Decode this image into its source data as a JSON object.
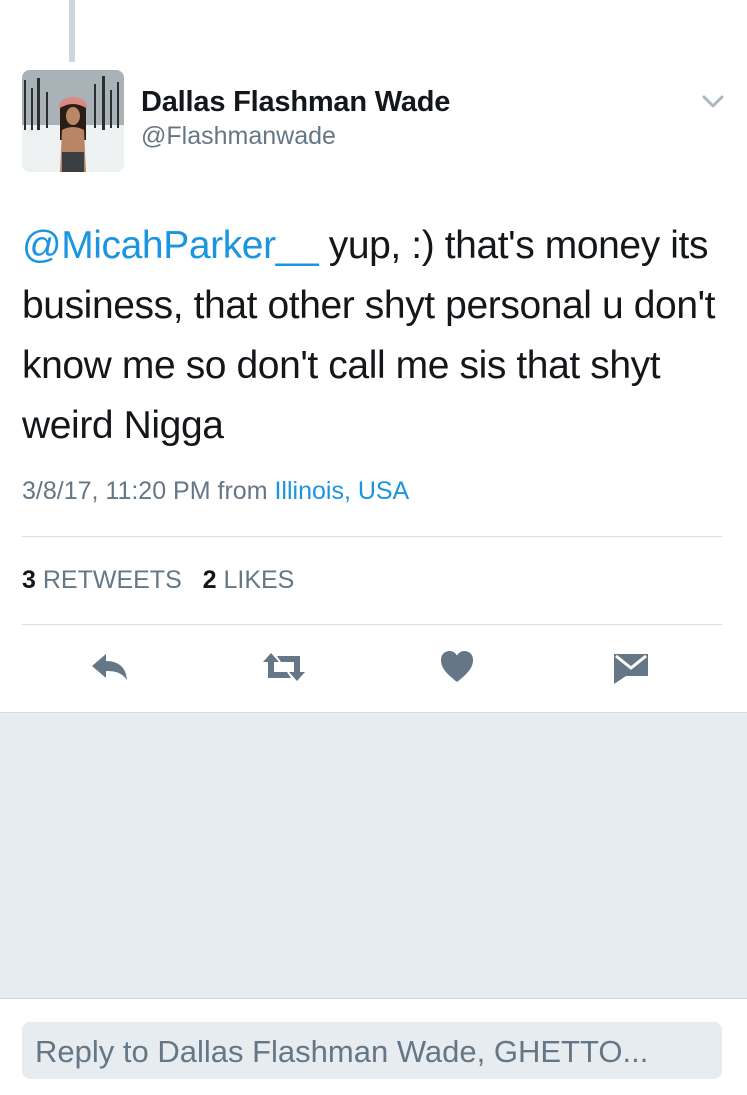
{
  "author": {
    "name": "Dallas Flashman Wade",
    "handle": "@Flashmanwade"
  },
  "tweet": {
    "mention": "@MicahParker__",
    "text": " yup, :) that's money its business, that other shyt personal u don't know me so don't call me sis that shyt weird Nigga",
    "timestamp": "3/8/17, 11:20 PM",
    "from_label": "from",
    "location": "Illinois, USA"
  },
  "stats": {
    "retweets_count": "3",
    "retweets_label": "RETWEETS",
    "likes_count": "2",
    "likes_label": "LIKES"
  },
  "actions": {
    "icons": [
      "reply-icon",
      "retweet-icon",
      "like-icon",
      "direct-message-icon"
    ]
  },
  "reply": {
    "placeholder": "Reply to Dallas Flashman Wade, GHETTO..."
  },
  "colors": {
    "accent": "#1b95e0",
    "text": "#14171a",
    "secondary": "#657786",
    "icon": "#657786",
    "background_gray": "#e6ecf0"
  }
}
